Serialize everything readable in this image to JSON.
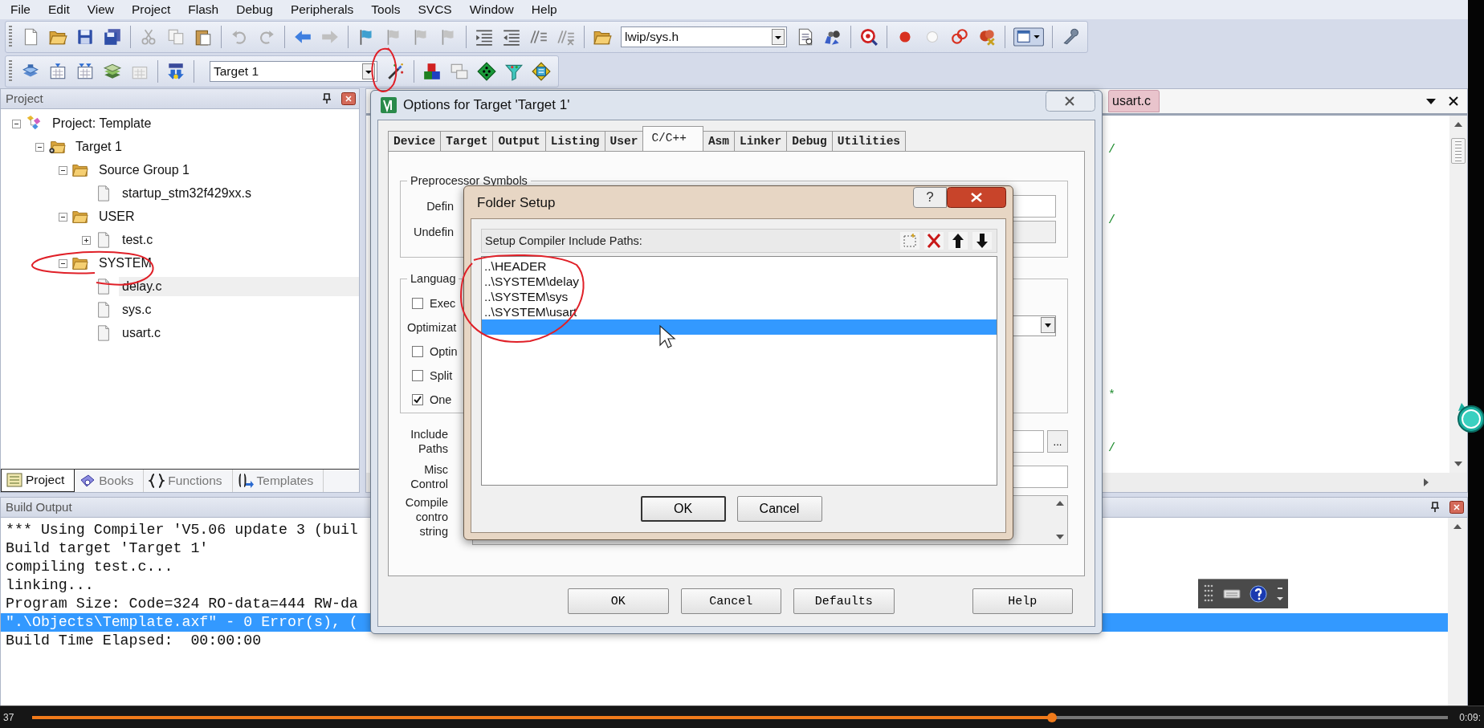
{
  "menu": [
    "File",
    "Edit",
    "View",
    "Project",
    "Flash",
    "Debug",
    "Peripherals",
    "Tools",
    "SVCS",
    "Window",
    "Help"
  ],
  "toolbar": {
    "file_combo": "lwip/sys.h",
    "target_combo": "Target 1"
  },
  "project_panel": {
    "title": "Project",
    "tree": [
      {
        "label": "Project: Template",
        "kind": "project",
        "expanded": true,
        "selected": false,
        "children": [
          {
            "label": "Target 1",
            "kind": "target",
            "expanded": true,
            "selected": false,
            "children": [
              {
                "label": "Source Group 1",
                "kind": "group",
                "expanded": true,
                "selected": false,
                "children": [
                  {
                    "label": "startup_stm32f429xx.s",
                    "kind": "file",
                    "selected": false
                  }
                ]
              },
              {
                "label": "USER",
                "kind": "group",
                "expanded": true,
                "selected": false,
                "children": [
                  {
                    "label": "test.c",
                    "kind": "file",
                    "expanded": false,
                    "selected": false
                  }
                ]
              },
              {
                "label": "SYSTEM",
                "kind": "group",
                "expanded": true,
                "selected": false,
                "children": [
                  {
                    "label": "delay.c",
                    "kind": "file",
                    "selected": true
                  },
                  {
                    "label": "sys.c",
                    "kind": "file",
                    "selected": false
                  },
                  {
                    "label": "usart.c",
                    "kind": "file",
                    "selected": false
                  }
                ]
              }
            ]
          }
        ]
      }
    ],
    "tabs": [
      {
        "label": "Project",
        "kind": "project",
        "selected": true
      },
      {
        "label": "Books",
        "kind": "books",
        "selected": false
      },
      {
        "label": "Functions",
        "kind": "functions",
        "selected": false
      },
      {
        "label": "Templates",
        "kind": "templates",
        "selected": false
      }
    ]
  },
  "editor": {
    "tab": "usart.c",
    "code_fragments": [
      "/",
      "/",
      "*",
      "/"
    ]
  },
  "build_output": {
    "title": "Build Output",
    "lines": [
      {
        "text": "*** Using Compiler 'V5.06 update 3 (buil",
        "selected": false
      },
      {
        "text": "Build target 'Target 1'",
        "selected": false
      },
      {
        "text": "compiling test.c...",
        "selected": false
      },
      {
        "text": "linking...",
        "selected": false
      },
      {
        "text": "Program Size: Code=324 RO-data=444 RW-da",
        "selected": false
      },
      {
        "text": "\".\\Objects\\Template.axf\" - 0 Error(s), (",
        "selected": true
      },
      {
        "text": "Build Time Elapsed:  00:00:00",
        "selected": false
      }
    ]
  },
  "options_dialog": {
    "title": "Options for Target 'Target 1'",
    "tabs": [
      {
        "label": "Device",
        "selected": false
      },
      {
        "label": "Target",
        "selected": false
      },
      {
        "label": "Output",
        "selected": false
      },
      {
        "label": "Listing",
        "selected": false
      },
      {
        "label": "User",
        "selected": false
      },
      {
        "label": "C/C++",
        "selected": true
      },
      {
        "label": "Asm",
        "selected": false
      },
      {
        "label": "Linker",
        "selected": false
      },
      {
        "label": "Debug",
        "selected": false
      },
      {
        "label": "Utilities",
        "selected": false
      }
    ],
    "preprocessor_group": "Preprocessor Symbols",
    "define_label": "Defin",
    "undefine_label": "Undefin",
    "language_group": "Languag",
    "language_rows": [
      {
        "kind": "checkbox",
        "label": "Exec",
        "checked": false
      },
      {
        "kind": "label",
        "label": "Optimizat"
      },
      {
        "kind": "checkbox",
        "label": "Optin",
        "checked": false
      },
      {
        "kind": "checkbox",
        "label": "Split",
        "checked": false
      },
      {
        "kind": "checkbox",
        "label": "One",
        "checked": true
      }
    ],
    "include_label": [
      "Include",
      "Paths"
    ],
    "misc_label": [
      "Misc",
      "Control"
    ],
    "compiler_label": [
      "Compile",
      "contro",
      "string"
    ],
    "browse_button": "...",
    "buttons": [
      "OK",
      "Cancel",
      "Defaults",
      "Help"
    ]
  },
  "folder_dialog": {
    "title": "Folder Setup",
    "help_button": "?",
    "list_label": "Setup Compiler Include Paths:",
    "paths": [
      {
        "text": "..\\HEADER",
        "selected": false
      },
      {
        "text": "..\\SYSTEM\\delay",
        "selected": false
      },
      {
        "text": "..\\SYSTEM\\sys",
        "selected": false
      },
      {
        "text": "..\\SYSTEM\\usart",
        "selected": false
      }
    ],
    "new_entry_selected": true,
    "buttons": [
      "OK",
      "Cancel"
    ]
  },
  "player": {
    "elapsed": "37",
    "total": "0:09:",
    "level": 0.72
  }
}
